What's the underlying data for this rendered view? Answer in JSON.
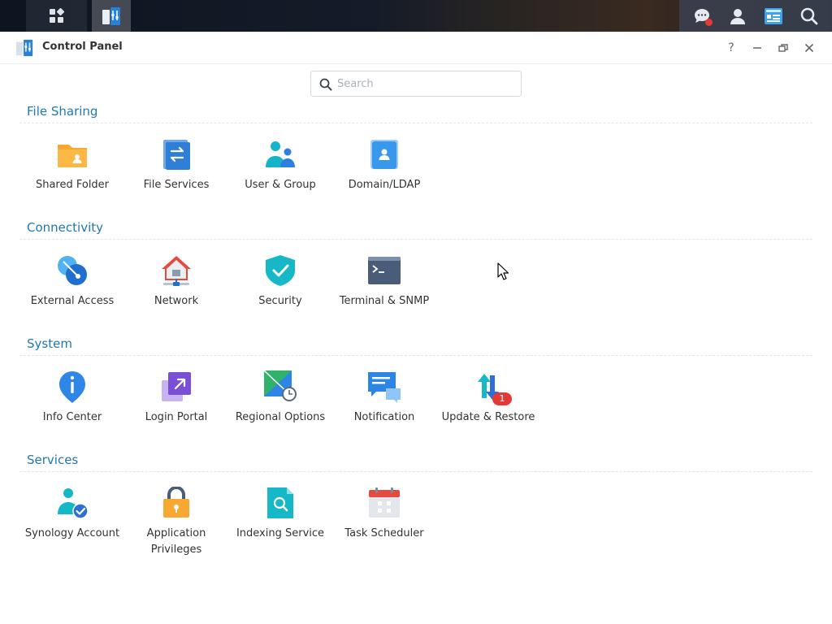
{
  "window": {
    "title": "Control Panel",
    "help_label": "?"
  },
  "search": {
    "placeholder": "Search",
    "value": ""
  },
  "sections": [
    {
      "title": "File Sharing",
      "items": [
        {
          "label": "Shared Folder",
          "icon": "shared-folder-icon"
        },
        {
          "label": "File Services",
          "icon": "file-services-icon"
        },
        {
          "label": "User & Group",
          "icon": "user-group-icon"
        },
        {
          "label": "Domain/LDAP",
          "icon": "domain-ldap-icon"
        }
      ]
    },
    {
      "title": "Connectivity",
      "items": [
        {
          "label": "External Access",
          "icon": "external-access-icon"
        },
        {
          "label": "Network",
          "icon": "network-icon"
        },
        {
          "label": "Security",
          "icon": "security-shield-icon"
        },
        {
          "label": "Terminal & SNMP",
          "icon": "terminal-icon"
        }
      ]
    },
    {
      "title": "System",
      "items": [
        {
          "label": "Info Center",
          "icon": "info-center-icon"
        },
        {
          "label": "Login Portal",
          "icon": "login-portal-icon"
        },
        {
          "label": "Regional Options",
          "icon": "regional-options-icon"
        },
        {
          "label": "Notification",
          "icon": "notification-icon"
        },
        {
          "label": "Update & Restore",
          "icon": "update-restore-icon",
          "badge": "1"
        }
      ]
    },
    {
      "title": "Services",
      "items": [
        {
          "label": "Synology Account",
          "icon": "synology-account-icon"
        },
        {
          "label": "Application Privileges",
          "icon": "application-privileges-icon"
        },
        {
          "label": "Indexing Service",
          "icon": "indexing-service-icon"
        },
        {
          "label": "Task Scheduler",
          "icon": "task-scheduler-icon"
        }
      ]
    }
  ],
  "colors": {
    "section_title": "#1f78b4",
    "accent": "#2d8cf0",
    "badge": "#e53935"
  }
}
